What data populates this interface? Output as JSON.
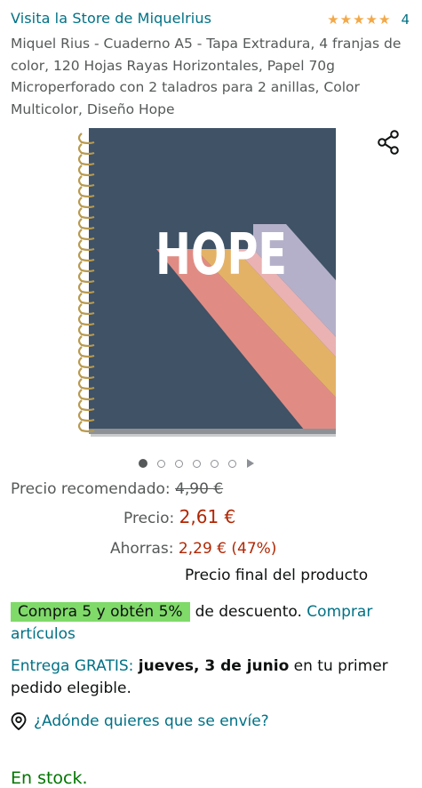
{
  "header": {
    "store_link": "Visita la Store de Miquelrius",
    "rating_count": "4",
    "stars": 5
  },
  "product": {
    "title": "Miquel Rius - Cuaderno A5 - Tapa Extradura, 4 franjas de color, 120 Hojas Rayas Horizontales, Papel 70g Microperforado con 2 taladros para 2 anillas, Color Multicolor, Diseño Hope",
    "cover_text": "HOPE"
  },
  "carousel": {
    "count": 6,
    "active": 0
  },
  "pricing": {
    "rrp_label": "Precio recomendado:",
    "rrp_value": "4,90 €",
    "price_label": "Precio:",
    "price_value": "2,61 €",
    "savings_label": "Ahorras:",
    "savings_value": "2,29 € (47%)",
    "final_note": "Precio final del producto"
  },
  "promo": {
    "badge": "Compra 5 y obtén 5%",
    "text": "de descuento.",
    "link": "Comprar artículos"
  },
  "delivery": {
    "prefix": "Entrega GRATIS:",
    "date": "jueves, 3 de junio",
    "suffix": "en tu primer pedido elegible."
  },
  "location": {
    "label": "¿Adónde quieres que se envíe?"
  },
  "stock": {
    "label": "En stock."
  },
  "colors": {
    "link": "#007185",
    "price": "#b12704",
    "stock": "#007600",
    "promo_badge": "#7fda69",
    "star": "#f3a847",
    "cover": "#3f5266"
  }
}
